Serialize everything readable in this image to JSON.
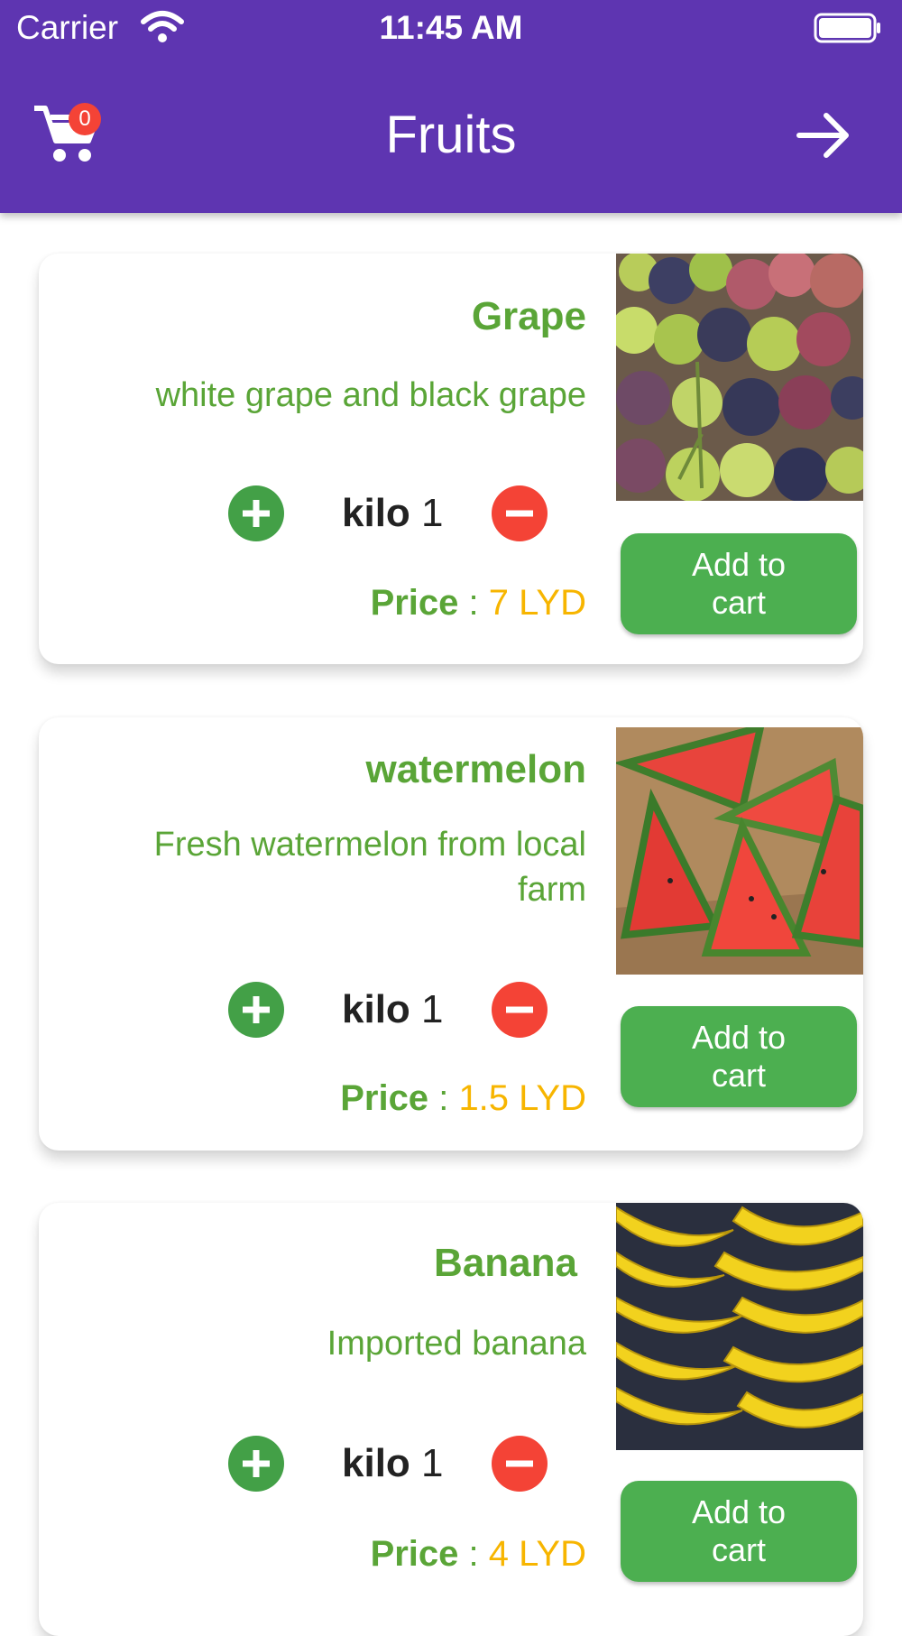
{
  "status_bar": {
    "carrier": "Carrier",
    "time": "11:45 AM"
  },
  "header": {
    "title": "Fruits",
    "cart_count": "0"
  },
  "colors": {
    "header": "#5e35b1",
    "green": "#5aa537",
    "button_green": "#4caf50",
    "red": "#f44336",
    "price": "#f7b500"
  },
  "products": [
    {
      "name": "Grape",
      "description": "white grape and black grape",
      "unit": "kilo",
      "quantity": "1",
      "price_label": "Price",
      "price_sep": ":",
      "price_value": "7 LYD",
      "add_label": "Add to cart"
    },
    {
      "name": "watermelon",
      "description": "Fresh watermelon from  local farm",
      "unit": "kilo",
      "quantity": "1",
      "price_label": "Price",
      "price_sep": ":",
      "price_value": "1.5 LYD",
      "add_label": "Add to cart"
    },
    {
      "name": "Banana",
      "description": "Imported banana",
      "unit": "kilo",
      "quantity": "1",
      "price_label": "Price",
      "price_sep": ":",
      "price_value": "4 LYD",
      "add_label": "Add to cart"
    }
  ]
}
